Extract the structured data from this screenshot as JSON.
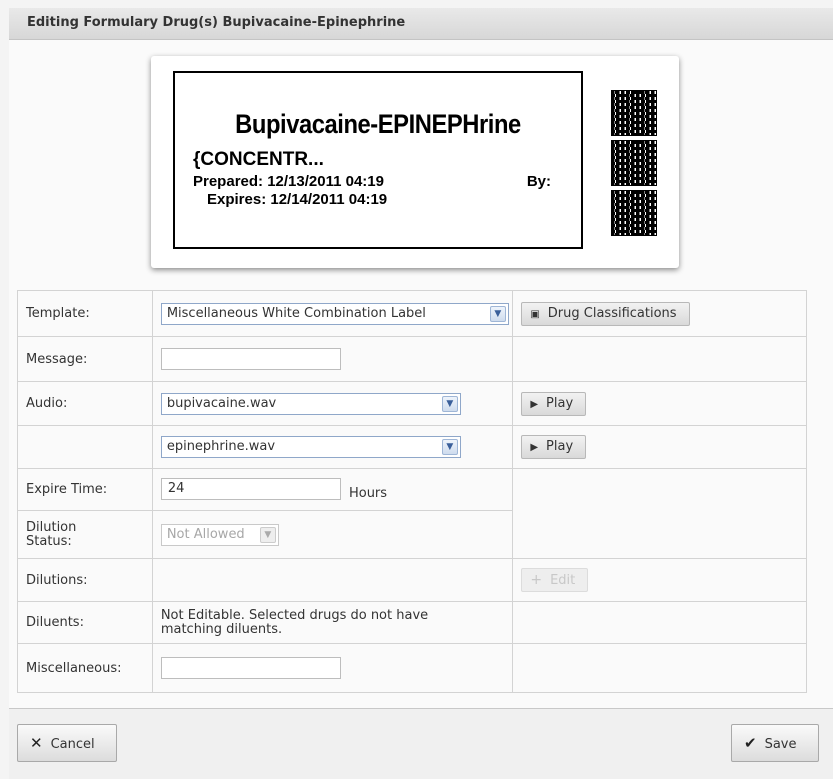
{
  "window": {
    "title": "Editing Formulary Drug(s) Bupivacaine-Epinephrine"
  },
  "label": {
    "drug_name": "Bupivacaine-EPINEPHrine",
    "concentration": "{CONCENTR...",
    "prepared": "Prepared:  12/13/2011 04:19",
    "by": "By:",
    "expires": "Expires:  12/14/2011 04:19"
  },
  "form": {
    "template": {
      "label": "Template:",
      "value": "Miscellaneous White Combination Label"
    },
    "drug_classifications_button": "Drug Classifications",
    "message": {
      "label": "Message:",
      "value": ""
    },
    "audio": {
      "label": "Audio:",
      "files": [
        "bupivacaine.wav",
        "epinephrine.wav"
      ],
      "play_label": "Play"
    },
    "expire_time": {
      "label": "Expire Time:",
      "value": "24",
      "unit": "Hours"
    },
    "dilution_status": {
      "label": "Dilution Status:",
      "value": "Not Allowed"
    },
    "dilutions": {
      "label": "Dilutions:",
      "edit_label": "Edit"
    },
    "diluents": {
      "label": "Diluents:",
      "text": "Not Editable. Selected drugs do not have matching diluents."
    },
    "miscellaneous": {
      "label": "Miscellaneous:",
      "value": ""
    }
  },
  "footer": {
    "cancel_label": "Cancel",
    "save_label": "Save"
  }
}
